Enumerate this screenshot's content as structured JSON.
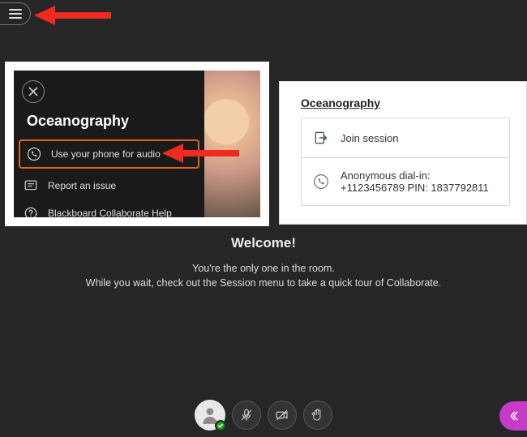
{
  "sidebar": {
    "title": "Oceanography",
    "items": [
      {
        "label": "Use your phone for audio"
      },
      {
        "label": "Report an issue"
      },
      {
        "label": "Blackboard Collaborate Help"
      }
    ]
  },
  "right_panel": {
    "title": "Oceanography",
    "join_label": "Join session",
    "dialin_label": "Anonymous dial-in:",
    "dialin_value": "+1123456789 PIN: 1837792811"
  },
  "welcome": {
    "heading": "Welcome!",
    "line1": "You're the only one in the room.",
    "line2": "While you wait, check out the Session menu to take a quick tour of Collaborate."
  }
}
